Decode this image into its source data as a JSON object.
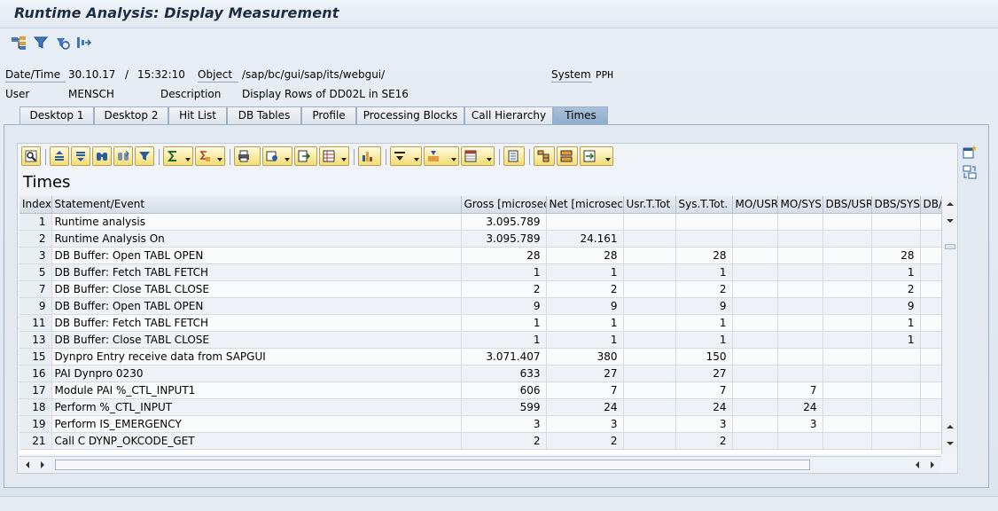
{
  "window": {
    "title": "Runtime Analysis: Display Measurement"
  },
  "app_toolbar": {
    "icons": [
      "hierarchy-icon",
      "filter-icon",
      "refresh-icon",
      "settings-icon"
    ]
  },
  "header": {
    "date_label": "Date/Time",
    "date_value": "30.10.17",
    "time_sep": "/",
    "time_value": "15:32:10",
    "object_label": "Object",
    "object_value": "/sap/bc/gui/sap/its/webgui/",
    "system_label": "System",
    "system_value": "PPH",
    "user_label": "User",
    "user_value": "MENSCH",
    "description_label": "Description",
    "description_value": "Display Rows of DD02L in SE16"
  },
  "tabs": [
    {
      "label": "Desktop 1"
    },
    {
      "label": "Desktop 2"
    },
    {
      "label": "Hit List"
    },
    {
      "label": "DB Tables"
    },
    {
      "label": "Profile"
    },
    {
      "label": "Processing Blocks"
    },
    {
      "label": "Call Hierarchy"
    },
    {
      "label": "Times",
      "active": true
    }
  ],
  "grid": {
    "title": "Times",
    "columns": [
      "Index",
      "Statement/Event",
      "Gross [microsec]",
      "Net [microsec]",
      "Usr.T.Tot",
      "Sys.T.Tot.",
      "MO/USR",
      "MO/SYS",
      "DBS/USR",
      "DBS/SYS",
      "DB/"
    ],
    "rows": [
      [
        "1",
        "Runtime analysis",
        "3.095.789",
        "",
        "",
        "",
        "",
        "",
        "",
        "",
        ""
      ],
      [
        "2",
        "Runtime Analysis On",
        "3.095.789",
        "24.161",
        "",
        "",
        "",
        "",
        "",
        "",
        ""
      ],
      [
        "3",
        "DB Buffer: Open TABL OPEN",
        "28",
        "28",
        "",
        "28",
        "",
        "",
        "",
        "28",
        ""
      ],
      [
        "5",
        "DB Buffer: Fetch TABL FETCH",
        "1",
        "1",
        "",
        "1",
        "",
        "",
        "",
        "1",
        ""
      ],
      [
        "7",
        "DB Buffer: Close TABL CLOSE",
        "2",
        "2",
        "",
        "2",
        "",
        "",
        "",
        "2",
        ""
      ],
      [
        "9",
        "DB Buffer: Open TABL OPEN",
        "9",
        "9",
        "",
        "9",
        "",
        "",
        "",
        "9",
        ""
      ],
      [
        "11",
        "DB Buffer: Fetch TABL FETCH",
        "1",
        "1",
        "",
        "1",
        "",
        "",
        "",
        "1",
        ""
      ],
      [
        "13",
        "DB Buffer: Close TABL CLOSE",
        "1",
        "1",
        "",
        "1",
        "",
        "",
        "",
        "1",
        ""
      ],
      [
        "15",
        "Dynpro Entry receive data from SAPGUI",
        "3.071.407",
        "380",
        "",
        "150",
        "",
        "",
        "",
        "",
        ""
      ],
      [
        "16",
        "PAI Dynpro 0230",
        "633",
        "27",
        "",
        "27",
        "",
        "",
        "",
        "",
        ""
      ],
      [
        "17",
        "Module PAI %_CTL_INPUT1",
        "606",
        "7",
        "",
        "7",
        "",
        "7",
        "",
        "",
        ""
      ],
      [
        "18",
        "Perform %_CTL_INPUT",
        "599",
        "24",
        "",
        "24",
        "",
        "24",
        "",
        "",
        ""
      ],
      [
        "19",
        "Perform IS_EMERGENCY",
        "3",
        "3",
        "",
        "3",
        "",
        "3",
        "",
        "",
        ""
      ],
      [
        "21",
        "Call C DYNP_OKCODE_GET",
        "2",
        "2",
        "",
        "2",
        "",
        "",
        "",
        "",
        ""
      ]
    ]
  }
}
